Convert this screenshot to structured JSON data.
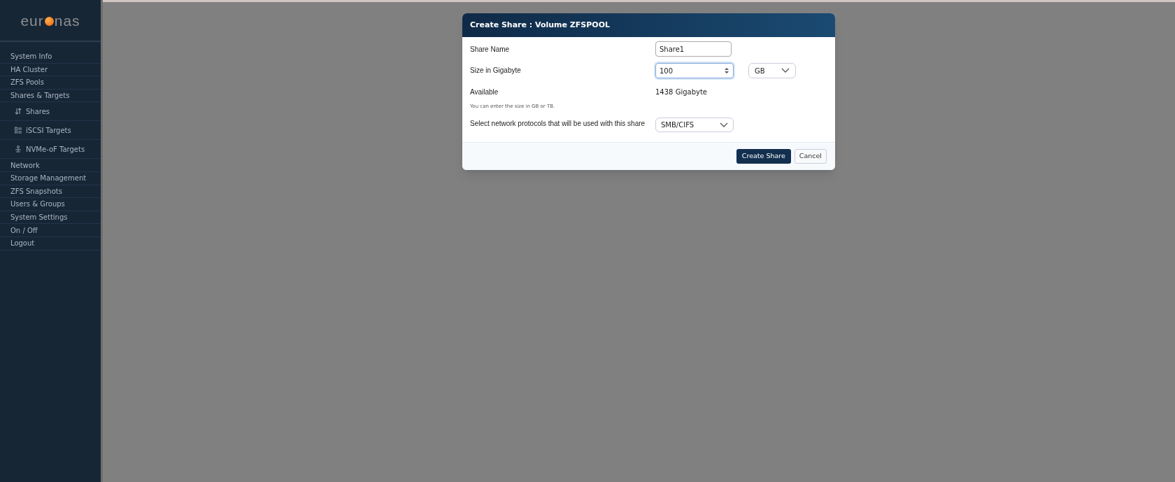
{
  "logo": {
    "before": "eur",
    "after": "nas"
  },
  "sidebar": {
    "items": [
      {
        "label": "System Info",
        "kind": "main"
      },
      {
        "label": "HA Cluster",
        "kind": "main"
      },
      {
        "label": "ZFS Pools",
        "kind": "main"
      },
      {
        "label": "Shares & Targets",
        "kind": "main"
      },
      {
        "label": "Shares",
        "kind": "sub"
      },
      {
        "label": "iSCSI Targets",
        "kind": "sub"
      },
      {
        "label": "NVMe-oF Targets",
        "kind": "sub"
      },
      {
        "label": "Network",
        "kind": "main"
      },
      {
        "label": "Storage Management",
        "kind": "main"
      },
      {
        "label": "ZFS Snapshots",
        "kind": "main"
      },
      {
        "label": "Users & Groups",
        "kind": "main"
      },
      {
        "label": "System Settings",
        "kind": "main"
      },
      {
        "label": "On / Off",
        "kind": "main"
      },
      {
        "label": "Logout",
        "kind": "main"
      }
    ]
  },
  "dialog": {
    "title": "Create Share : Volume ZFSPOOL",
    "share_name": {
      "label": "Share Name",
      "value": "Share1"
    },
    "size": {
      "label": "Size in Gigabyte",
      "value": "100",
      "unit": "GB"
    },
    "available": {
      "label": "Available",
      "value": "1438 Gigabyte"
    },
    "hint": "You can enter the size in GB or TB.",
    "protocols": {
      "label": "Select network protocols that will be used with this share",
      "value": "SMB/CIFS"
    },
    "buttons": [
      {
        "label": "Create Share",
        "kind": "primary"
      },
      {
        "label": "Cancel",
        "kind": "secondary"
      }
    ]
  }
}
